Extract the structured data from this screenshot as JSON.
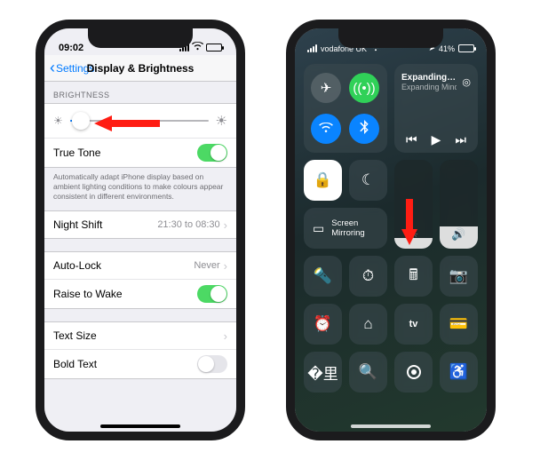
{
  "left": {
    "time": "09:02",
    "back_label": "Settings",
    "title": "Display & Brightness",
    "section_brightness": "BRIGHTNESS",
    "true_tone": "True Tone",
    "true_tone_desc": "Automatically adapt iPhone display based on ambient lighting conditions to make colours appear consistent in different environments.",
    "night_shift": "Night Shift",
    "night_shift_val": "21:30 to 08:30",
    "auto_lock": "Auto-Lock",
    "auto_lock_val": "Never",
    "raise_to_wake": "Raise to Wake",
    "text_size": "Text Size",
    "bold_text": "Bold Text"
  },
  "right": {
    "carrier": "vodafone UK",
    "battery_pct": "41%",
    "media_title": "Expanding Min…",
    "media_sub": "Expanding Mind",
    "screen_mirror": "Screen Mirroring",
    "appletv": "tv"
  }
}
